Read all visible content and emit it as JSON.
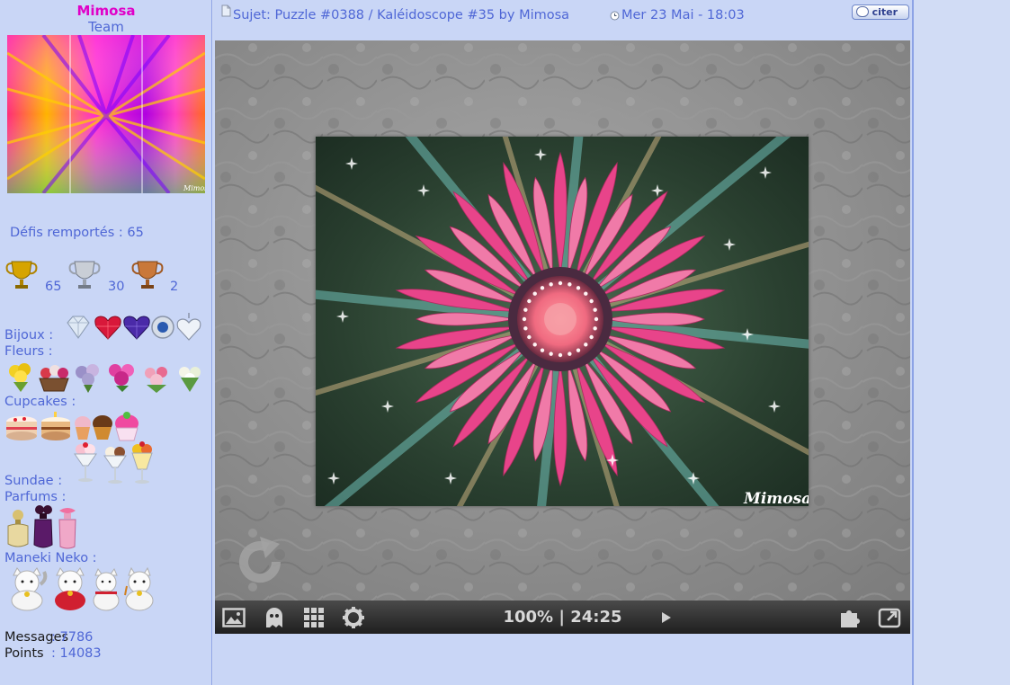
{
  "profile": {
    "username": "Mimosa",
    "rank": "Team",
    "avatar_watermark": "Mimosa",
    "defis_label": "Défis remportés : 65",
    "trophies": [
      {
        "icon": "gold-trophy-icon",
        "count": "65"
      },
      {
        "icon": "silver-trophy-icon",
        "count": "30"
      },
      {
        "icon": "bronze-trophy-icon",
        "count": "2"
      }
    ],
    "bijoux_label": "Bijoux :",
    "fleurs_label": "Fleurs :",
    "cupcakes_label": "Cupcakes :",
    "sundae_label": "Sundae :",
    "parfums_label": "Parfums :",
    "maneki_label": "Maneki Neko :",
    "messages_label": "Messages",
    "messages_value": ": 7786",
    "points_label": "Points",
    "points_value": ": 14083"
  },
  "post": {
    "subject": "Sujet: Puzzle #0388 / Kaléidoscope #35 by Mimosa",
    "date": "Mer 23 Mai - 18:03",
    "quote_label": "citer"
  },
  "puzzle": {
    "watermark": "Mimosa",
    "zoom": "100%",
    "separator": "|",
    "timer": "24:25"
  },
  "colors": {
    "username": "#e000c8",
    "text": "#4f67d6",
    "panel": "#c9d6f6",
    "toolbar": "#2a2a2a",
    "flower": "#f06a9a"
  }
}
